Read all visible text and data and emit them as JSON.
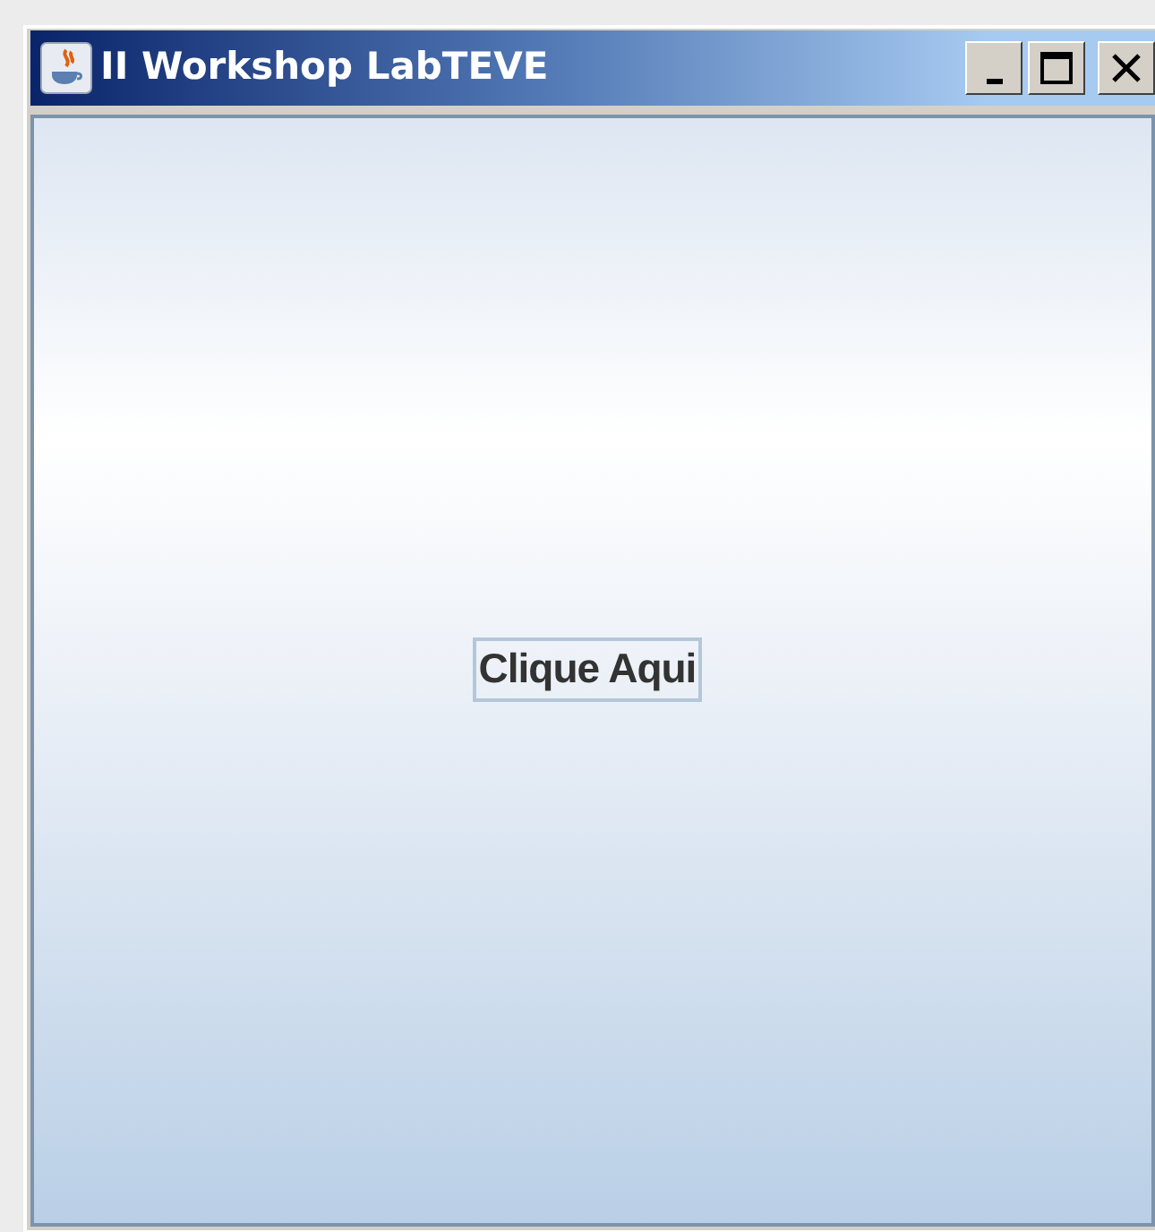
{
  "window": {
    "title": "II Workshop LabTEVE"
  },
  "content": {
    "button": "Clique Aqui"
  }
}
